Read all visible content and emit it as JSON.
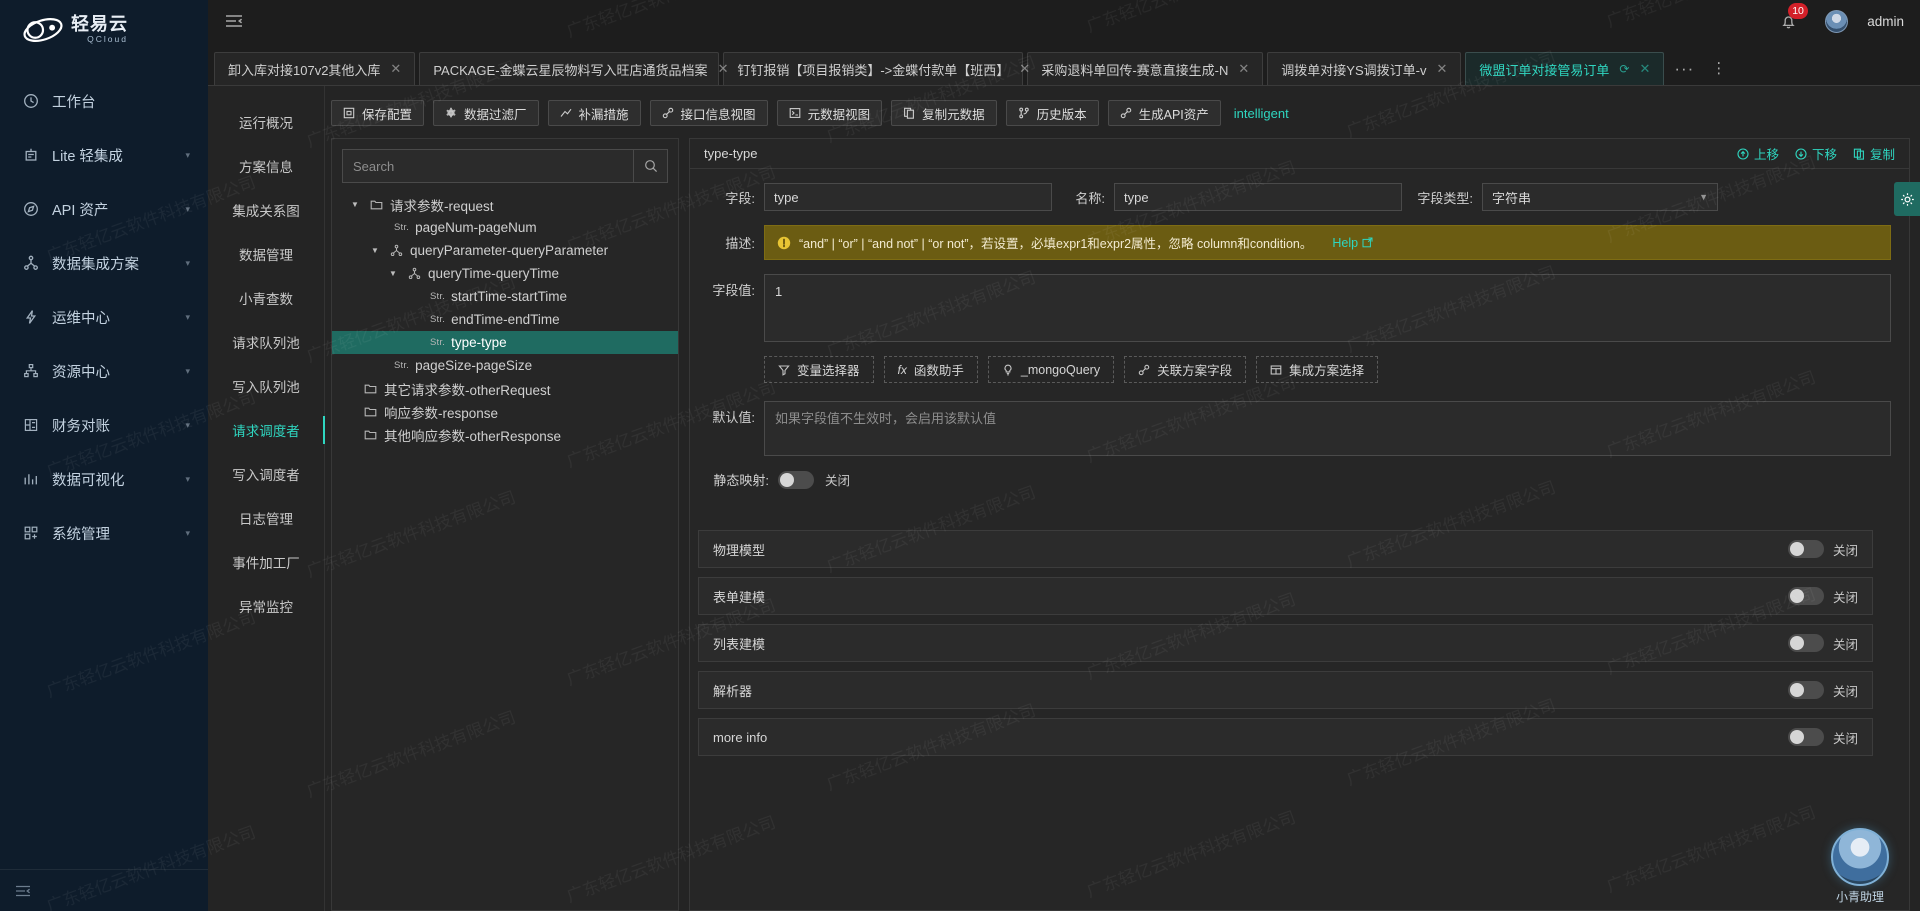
{
  "brand": {
    "name_cn": "轻易云",
    "name_en": "QCloud"
  },
  "sidebar": {
    "items": [
      {
        "label": "工作台",
        "icon": "clock-icon",
        "expandable": false
      },
      {
        "label": "Lite 轻集成",
        "icon": "lite-icon",
        "expandable": true
      },
      {
        "label": "API 资产",
        "icon": "compass-icon",
        "expandable": true
      },
      {
        "label": "数据集成方案",
        "icon": "sitemap-icon",
        "expandable": true
      },
      {
        "label": "运维中心",
        "icon": "bolt-icon",
        "expandable": true
      },
      {
        "label": "资源中心",
        "icon": "cluster-icon",
        "expandable": true
      },
      {
        "label": "财务对账",
        "icon": "ledger-icon",
        "expandable": true
      },
      {
        "label": "数据可视化",
        "icon": "chart-icon",
        "expandable": true
      },
      {
        "label": "系统管理",
        "icon": "grid-icon",
        "expandable": true
      }
    ]
  },
  "topbar": {
    "menu_icon": "collapse-menu-icon",
    "notification_count": "10",
    "username": "admin"
  },
  "tabs": [
    {
      "label": "卸入库对接107v2其他入库",
      "active": false
    },
    {
      "label": "PACKAGE-金蝶云星辰物料写入旺店通货品档案",
      "active": false
    },
    {
      "label": "钉钉报销【项目报销类】->金蝶付款单【班西】",
      "active": false
    },
    {
      "label": "采购退料单回传-赛意直接生成-N",
      "active": false
    },
    {
      "label": "调拨单对接YS调拨订单-v",
      "active": false
    },
    {
      "label": "微盟订单对接管易订单",
      "active": true
    }
  ],
  "colmenu": {
    "items": [
      {
        "label": "运行概况",
        "active": false
      },
      {
        "label": "方案信息",
        "active": false
      },
      {
        "label": "集成关系图",
        "active": false
      },
      {
        "label": "数据管理",
        "active": false
      },
      {
        "label": "小青查数",
        "active": false
      },
      {
        "label": "请求队列池",
        "active": false
      },
      {
        "label": "写入队列池",
        "active": false
      },
      {
        "label": "请求调度者",
        "active": true
      },
      {
        "label": "写入调度者",
        "active": false
      },
      {
        "label": "日志管理",
        "active": false
      },
      {
        "label": "事件加工厂",
        "active": false
      },
      {
        "label": "异常监控",
        "active": false
      }
    ]
  },
  "toolbar": {
    "buttons": [
      {
        "label": "保存配置",
        "icon": "save-icon"
      },
      {
        "label": "数据过滤厂",
        "icon": "gear-icon"
      },
      {
        "label": "补漏措施",
        "icon": "trend-icon"
      },
      {
        "label": "接口信息视图",
        "icon": "link-icon"
      },
      {
        "label": "元数据视图",
        "icon": "terminal-icon"
      },
      {
        "label": "复制元数据",
        "icon": "copy-icon"
      },
      {
        "label": "历史版本",
        "icon": "branch-icon"
      },
      {
        "label": "生成API资产",
        "icon": "link-icon"
      }
    ],
    "link_label": "intelligent"
  },
  "tree": {
    "search_placeholder": "Search",
    "search_value": "",
    "search_icon": "search-icon",
    "nodes": [
      {
        "label": "请求参数-request",
        "type": "folder",
        "depth": 0,
        "caret": "down",
        "selected": false
      },
      {
        "label": "pageNum-pageNum",
        "type": "str",
        "depth": 1,
        "caret": "none",
        "selected": false
      },
      {
        "label": "queryParameter-queryParameter",
        "type": "object",
        "depth": 1,
        "caret": "down",
        "selected": false
      },
      {
        "label": "queryTime-queryTime",
        "type": "object",
        "depth": 2,
        "caret": "down",
        "selected": false
      },
      {
        "label": "startTime-startTime",
        "type": "str",
        "depth": 3,
        "caret": "none",
        "selected": false
      },
      {
        "label": "endTime-endTime",
        "type": "str",
        "depth": 3,
        "caret": "none",
        "selected": false
      },
      {
        "label": "type-type",
        "type": "str",
        "depth": 3,
        "caret": "none",
        "selected": true
      },
      {
        "label": "pageSize-pageSize",
        "type": "str",
        "depth": 1,
        "caret": "none",
        "selected": false
      },
      {
        "label": "其它请求参数-otherRequest",
        "type": "folder",
        "depth": 0,
        "caret": "none",
        "selected": false
      },
      {
        "label": "响应参数-response",
        "type": "folder",
        "depth": 0,
        "caret": "none",
        "selected": false
      },
      {
        "label": "其他响应参数-otherResponse",
        "type": "folder",
        "depth": 0,
        "caret": "none",
        "selected": false
      }
    ],
    "str_tag": "Str."
  },
  "form": {
    "title": "type-type",
    "head_actions": [
      {
        "label": "上移",
        "icon": "arrow-up-circle-icon"
      },
      {
        "label": "下移",
        "icon": "arrow-down-circle-icon"
      },
      {
        "label": "复制",
        "icon": "copy-icon"
      }
    ],
    "field_label": "字段:",
    "field_value": "type",
    "name_label": "名称:",
    "name_value": "type",
    "type_label": "字段类型:",
    "type_value": "字符串",
    "desc_label": "描述:",
    "desc_text": "“and” | “or” | “and not” | “or not”，若设置，必填expr1和expr2属性，忽略 column和condition。",
    "desc_help": "Help",
    "value_label": "字段值:",
    "value_text": "1",
    "chips": [
      {
        "label": "变量选择器",
        "icon": "filter-icon"
      },
      {
        "label": "函数助手",
        "icon": "fx-icon"
      },
      {
        "label": "_mongoQuery",
        "icon": "bulb-icon"
      },
      {
        "label": "关联方案字段",
        "icon": "link-icon"
      },
      {
        "label": "集成方案选择",
        "icon": "table-icon"
      }
    ],
    "default_label": "默认值:",
    "default_placeholder": "如果字段值不生效时，会启用该默认值",
    "static_map_label": "静态映射:",
    "static_map_state": "关闭"
  },
  "sections": [
    {
      "title": "物理模型",
      "state": "关闭"
    },
    {
      "title": "表单建模",
      "state": "关闭"
    },
    {
      "title": "列表建模",
      "state": "关闭"
    },
    {
      "title": "解析器",
      "state": "关闭"
    },
    {
      "title": "more info",
      "state": "关闭"
    }
  ],
  "assistant": {
    "label": "小青助理"
  },
  "watermark_text": "广东轻亿云软件科技有限公司",
  "colors": {
    "accent": "#2fd6c0",
    "sidebar_bg": "#0e1c2b",
    "panel_bg": "#262626",
    "warn_bg": "#6b5c12",
    "badge": "#d32029"
  }
}
